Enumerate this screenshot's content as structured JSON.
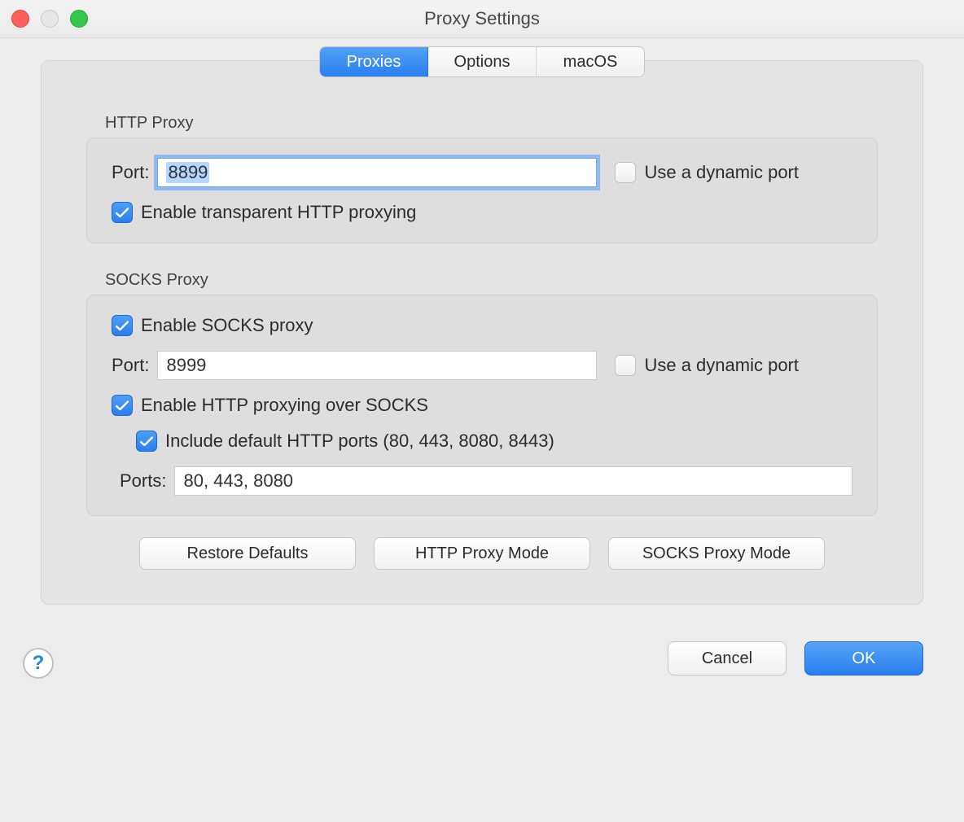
{
  "window_title": "Proxy Settings",
  "tabs": {
    "proxies": "Proxies",
    "options": "Options",
    "macos": "macOS"
  },
  "http_section_label": "HTTP Proxy",
  "http": {
    "port_label": "Port:",
    "port_value": "8899",
    "dynamic_label": "Use a dynamic port",
    "enable_transparent_label": "Enable transparent HTTP proxying"
  },
  "socks_section_label": "SOCKS Proxy",
  "socks": {
    "enable_label": "Enable SOCKS proxy",
    "port_label": "Port:",
    "port_value": "8999",
    "dynamic_label": "Use a dynamic port",
    "http_over_socks_label": "Enable HTTP proxying over SOCKS",
    "include_default_label": "Include default HTTP ports (80, 443, 8080, 8443)",
    "ports_label": "Ports:",
    "ports_value": "80, 443, 8080"
  },
  "buttons": {
    "restore": "Restore Defaults",
    "http_mode": "HTTP Proxy Mode",
    "socks_mode": "SOCKS Proxy Mode",
    "cancel": "Cancel",
    "ok": "OK"
  },
  "help_glyph": "?"
}
